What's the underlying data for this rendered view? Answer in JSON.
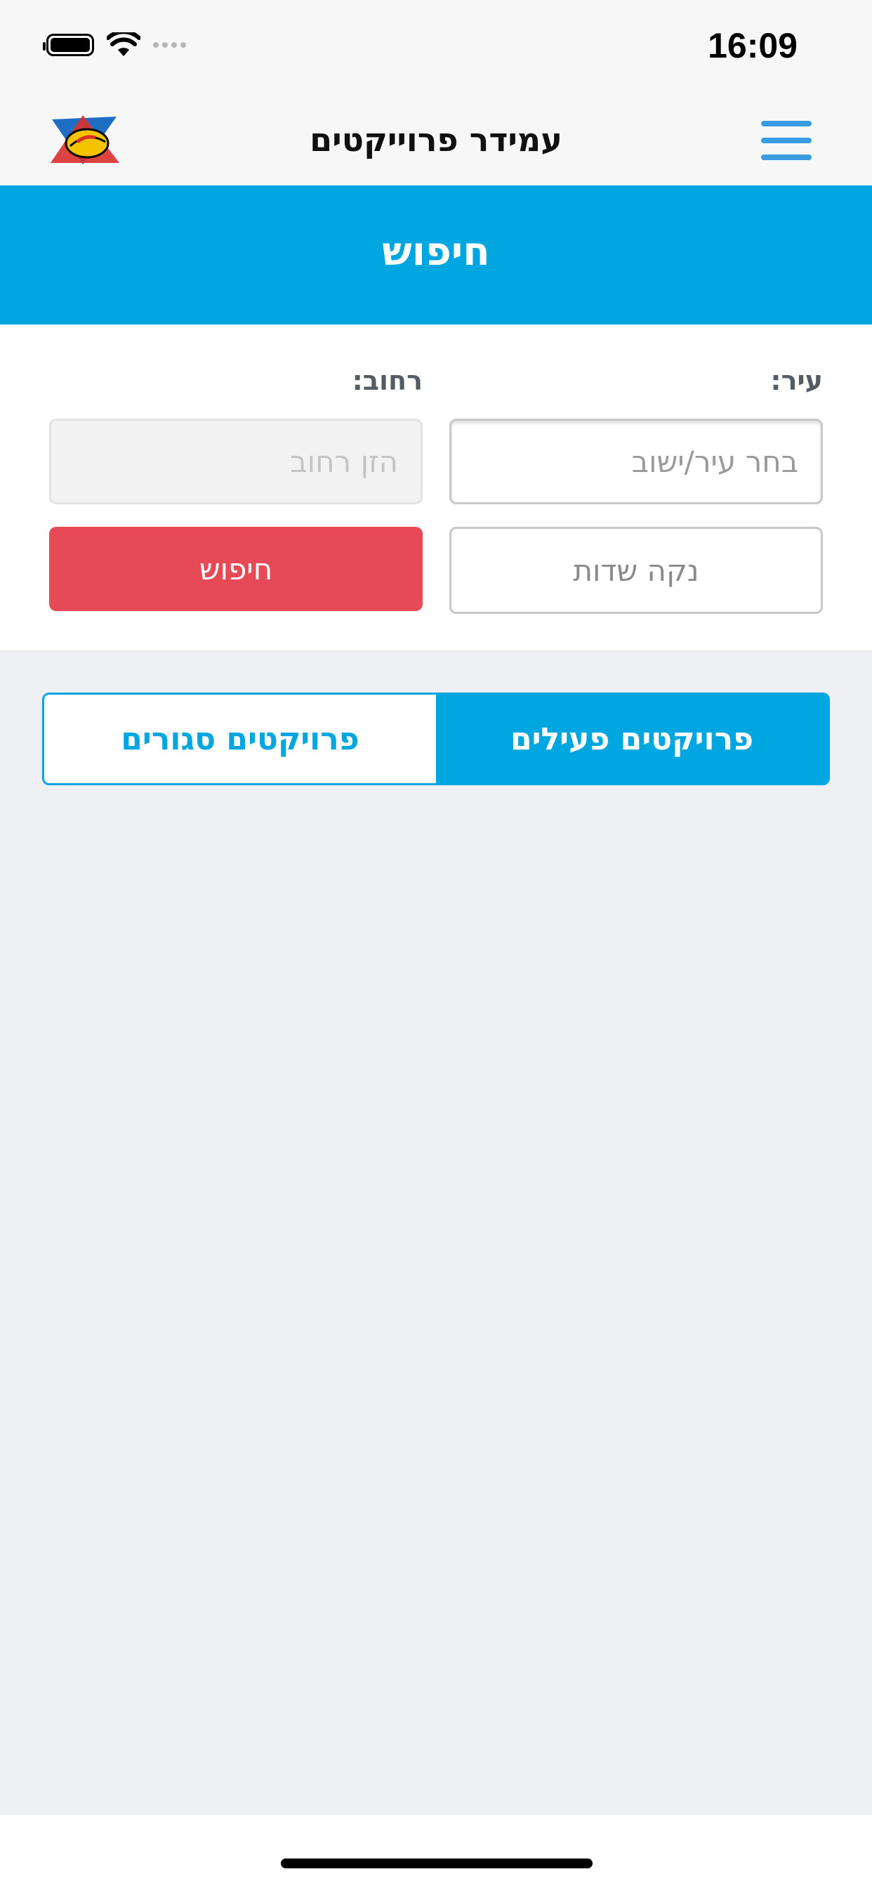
{
  "status_bar": {
    "time": "16:09"
  },
  "nav": {
    "title": "עמידר פרוייקטים",
    "logo_icon": "amidar-logo-icon",
    "menu_icon": "hamburger-menu-icon"
  },
  "search_header": {
    "title": "חיפוש"
  },
  "form": {
    "city_label": "עיר:",
    "city_placeholder": "בחר עיר/ישוב",
    "street_label": "רחוב:",
    "street_placeholder": "הזן רחוב",
    "clear_button": "נקה שדות",
    "search_button": "חיפוש"
  },
  "tabs": {
    "active": "פרויקטים פעילים",
    "closed": "פרויקטים סגורים"
  },
  "colors": {
    "primary": "#00a6df",
    "danger": "#e64a56"
  }
}
